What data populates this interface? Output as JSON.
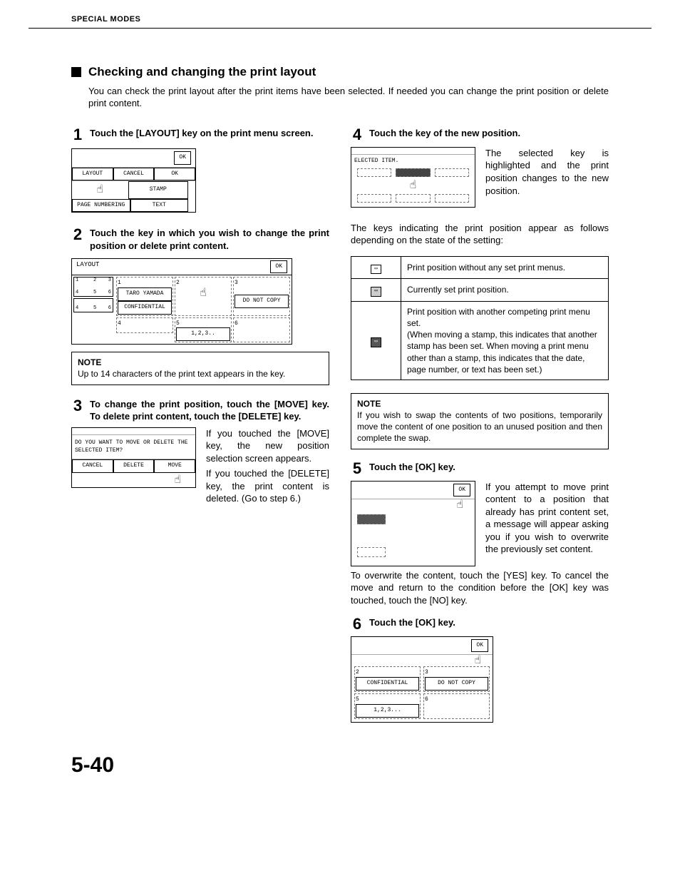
{
  "header": {
    "section": "SPECIAL MODES"
  },
  "title": "Checking and changing the print layout",
  "intro": "You can check the print layout after the print items have been selected. If needed you can change the print position or delete print content.",
  "steps": {
    "s1": {
      "num": "1",
      "text": "Touch the [LAYOUT] key on the print menu screen."
    },
    "s2": {
      "num": "2",
      "text": "Touch the key in which you wish to change the print position or delete print content."
    },
    "s3": {
      "num": "3",
      "text": "To change the print position, touch the [MOVE] key. To delete print content, touch the [DELETE] key."
    },
    "s4": {
      "num": "4",
      "text": "Touch the key of the new position."
    },
    "s5": {
      "num": "5",
      "text": "Touch the [OK] key."
    },
    "s6": {
      "num": "6",
      "text": "Touch the [OK] key."
    }
  },
  "fig1": {
    "ok": "OK",
    "layout": "LAYOUT",
    "cancel": "CANCEL",
    "ok2": "OK",
    "page_numbering": "PAGE NUMBERING",
    "stamp": "STAMP",
    "text": "TEXT"
  },
  "fig2": {
    "title": "LAYOUT",
    "ok": "OK",
    "cell_taro": "TARO YAMADA",
    "cell_conf": "CONFIDENTIAL",
    "cell_dnc": "DO NOT COPY",
    "cell_num": "1,2,3..",
    "n1": "1",
    "n2": "2",
    "n3": "3",
    "n4": "4",
    "n5": "5",
    "n6": "6"
  },
  "note1": {
    "label": "NOTE",
    "text": "Up to 14 characters of the print text appears in the key."
  },
  "fig3": {
    "prompt": "DO YOU WANT TO MOVE OR DELETE THE SELECTED ITEM?",
    "cancel": "CANCEL",
    "delete": "DELETE",
    "move": "MOVE"
  },
  "desc3a": "If you touched the [MOVE] key, the new position selection screen appears.",
  "desc3b": "If you touched the [DELETE] key, the print content is deleted. (Go to step 6.)",
  "fig4": {
    "title": "ELECTED ITEM."
  },
  "desc4": "The selected key is highlighted and the print position changes to the new position.",
  "para4b": "The keys indicating the print position appear as follows depending on the state of the setting:",
  "pp_table": {
    "r1": "Print position without any set print menus.",
    "r2": "Currently set print position.",
    "r3": "Print position with another competing print menu set.\n(When moving a stamp, this indicates that another stamp has been set. When moving a print menu other than a stamp, this indicates that the date, page number, or text has been set.)"
  },
  "note2": {
    "label": "NOTE",
    "text": "If you wish to swap the contents of two positions, temporarily move the content of one position to an unused position and then complete the swap."
  },
  "fig5": {
    "ok": "OK"
  },
  "desc5": "If you attempt to move print content to a position that already has print content set, a message will appear asking you if you wish to overwrite the previously set content.",
  "para5b": "To overwrite the content, touch the [YES] key. To cancel the move and return to the condition before the [OK] key was touched, touch the [NO] key.",
  "fig6": {
    "ok": "OK",
    "n2": "2",
    "n3": "3",
    "n5": "5",
    "n6": "6",
    "conf": "CONFIDENTIAL",
    "dnc": "DO NOT COPY",
    "num": "1,2,3..."
  },
  "page_number": "5-40"
}
